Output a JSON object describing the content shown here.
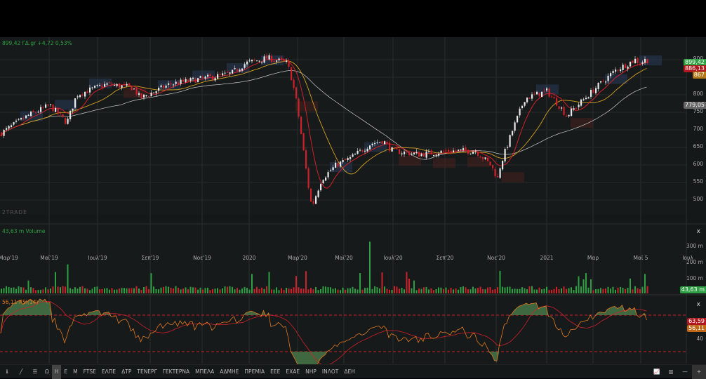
{
  "header": {
    "quote": "899,42 ΓΔ.gr +4,72 0,53%"
  },
  "watermark": "2TRADE",
  "price_axis": {
    "labels": [
      "900",
      "850",
      "800",
      "750",
      "700",
      "650",
      "600",
      "550",
      "500"
    ],
    "tags": {
      "last": "899,42",
      "ma_fast": "886,13",
      "ma_mid": "867",
      "ma_slow": "779,05"
    }
  },
  "x_axis": {
    "labels": [
      "Μαρ'19",
      "Μαϊ'19",
      "Ιουλ'19",
      "Σεπ'19",
      "Νοε'19",
      "2020",
      "Μαρ'20",
      "Μαϊ'20",
      "Ιουλ'20",
      "Σεπ'20",
      "Νοε'20",
      "2021",
      "Μαρ",
      "Μαϊ 5",
      "Ιουλ"
    ]
  },
  "volume_panel": {
    "title": "43,63 m Volume",
    "labels": [
      "300 m",
      "200 m",
      "100 m"
    ],
    "tag": "43,63 m",
    "close": "x"
  },
  "rsi_panel": {
    "title": "56,11 RSI(14)",
    "labels": [
      "40"
    ],
    "tags": {
      "signal": "63,59",
      "rsi": "56,11"
    },
    "close": "x"
  },
  "colors": {
    "up": "#2ea043",
    "down": "#d0202a",
    "ma_fast": "#d0202a",
    "ma_mid": "#d4a020",
    "ma_slow": "#cccccc",
    "rsi": "#e07820"
  },
  "toolbar": {
    "items": [
      "Ω",
      "Η",
      "Ε",
      "Μ",
      "FTSE",
      "ΕΛΠΕ",
      "ΔΤΡ",
      "ΤΕΝΕΡΓ",
      "ΓΕΚΤΕΡΝΑ",
      "ΜΠΕΛΑ",
      "ΑΔΜΗΕ",
      "ΠΡΕΜΙΑ",
      "ΕΕΕ",
      "ΕΧΑΕ",
      "ΝΗΡ",
      "ΙΝΛΟΤ",
      "ΔΕΗ"
    ],
    "active": "Η"
  },
  "chart_data": {
    "type": "candlestick",
    "title": "ΓΔ.gr",
    "ylim": [
      470,
      920
    ],
    "keypoints_month_price": [
      [
        0,
        690
      ],
      [
        1.1,
        740
      ],
      [
        2,
        770
      ],
      [
        2.7,
        720
      ],
      [
        3.1,
        800
      ],
      [
        4.3,
        830
      ],
      [
        5.4,
        820
      ],
      [
        5.7,
        790
      ],
      [
        6.9,
        830
      ],
      [
        7.7,
        840
      ],
      [
        8.6,
        850
      ],
      [
        9.4,
        860
      ],
      [
        10,
        890
      ],
      [
        10.9,
        905
      ],
      [
        11.7,
        890
      ],
      [
        11.9,
        840
      ],
      [
        12.1,
        770
      ],
      [
        12.6,
        520
      ],
      [
        12.7,
        480
      ],
      [
        13.1,
        560
      ],
      [
        13.7,
        600
      ],
      [
        14.3,
        620
      ],
      [
        15.1,
        660
      ],
      [
        15.6,
        670
      ],
      [
        16,
        640
      ],
      [
        17.1,
        630
      ],
      [
        18.3,
        640
      ],
      [
        19.4,
        640
      ],
      [
        20,
        600
      ],
      [
        20.3,
        560
      ],
      [
        20.4,
        600
      ],
      [
        20.9,
        700
      ],
      [
        21.4,
        790
      ],
      [
        22.3,
        810
      ],
      [
        22.9,
        760
      ],
      [
        23.1,
        740
      ],
      [
        23.7,
        780
      ],
      [
        24.3,
        820
      ],
      [
        25.1,
        870
      ],
      [
        25.9,
        900
      ],
      [
        26.1,
        890
      ],
      [
        26.3,
        899
      ]
    ]
  }
}
